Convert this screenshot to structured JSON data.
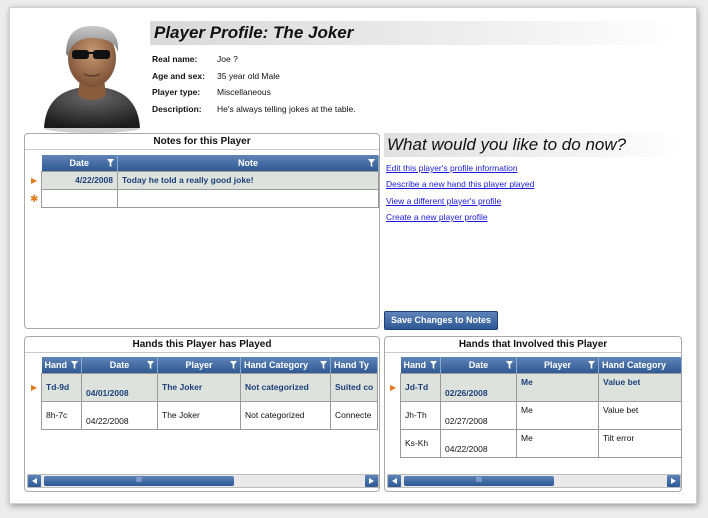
{
  "profile": {
    "title": "Player Profile: The Joker",
    "fields": [
      {
        "label": "Real name:",
        "value": "Joe ?"
      },
      {
        "label": "Age and sex:",
        "value": "35 year old Male"
      },
      {
        "label": "Player type:",
        "value": "Miscellaneous"
      },
      {
        "label": "Description:",
        "value": "He's always telling jokes at the table."
      }
    ]
  },
  "notes": {
    "title": "Notes for this Player",
    "columns": [
      "Date",
      "Note"
    ],
    "rows": [
      {
        "date": "4/22/2008",
        "note": "Today he told a really good joke!"
      }
    ]
  },
  "actions": {
    "title": "What would you like to do now?",
    "links": [
      "Edit this player's profile information",
      "Describe a new hand this player played",
      "View a different player's profile",
      "Create a new player profile"
    ],
    "save_label": "Save Changes to Notes"
  },
  "hands_played": {
    "title": "Hands this Player has Played",
    "columns": [
      "Hand",
      "Date",
      "Player",
      "Hand Category",
      "Hand Ty"
    ],
    "rows": [
      {
        "hand": "Td-9d",
        "date": "04/01/2008",
        "player": "The Joker",
        "category": "Not categorized",
        "type": "Suited co"
      },
      {
        "hand": "8h-7c",
        "date": "04/22/2008",
        "player": "The Joker",
        "category": "Not categorized",
        "type": "Connecte"
      }
    ]
  },
  "hands_involved": {
    "title": "Hands that Involved this Player",
    "columns": [
      "Hand",
      "Date",
      "Player",
      "Hand Category"
    ],
    "rows": [
      {
        "hand": "Jd-Td",
        "date": "02/26/2008",
        "player": "Me",
        "category": "Value bet"
      },
      {
        "hand": "Jh-Th",
        "date": "02/27/2008",
        "player": "Me",
        "category": "Value bet"
      },
      {
        "hand": "Ks-Kh",
        "date": "04/22/2008",
        "player": "Me",
        "category": "Tilt error"
      }
    ]
  },
  "colors": {
    "header_blue": "#2f5a95",
    "selected_row": "#dde3dc",
    "link": "#1a1ad8",
    "row_marker": "#e07a1a"
  },
  "icons": {
    "avatar": "player-avatar-icon",
    "filter": "filter-icon",
    "current_row": "current-row-arrow-icon",
    "new_row": "new-row-asterisk-icon",
    "scroll_left": "scroll-left-icon",
    "scroll_right": "scroll-right-icon"
  },
  "scroll_grip": "III",
  "current_row_marker": "▶",
  "new_row_marker": "✱"
}
